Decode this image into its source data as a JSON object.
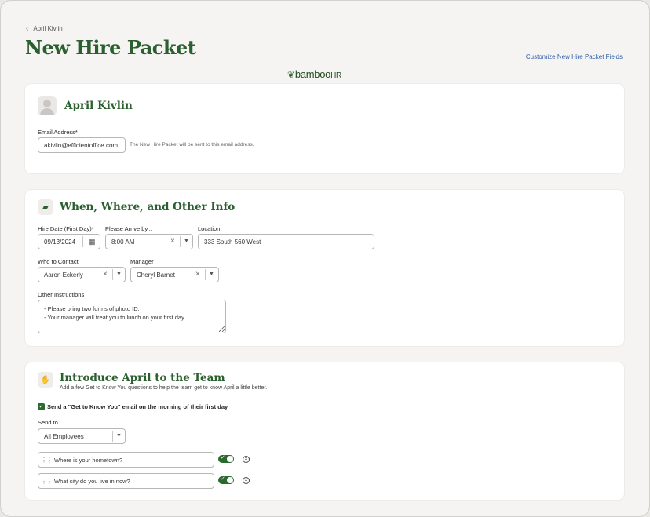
{
  "breadcrumb": {
    "back_label": "April Kivlin"
  },
  "page_title": "New Hire Packet",
  "customize_link": "Customize New Hire Packet Fields",
  "logo": {
    "text": "bamboo",
    "suffix": "HR"
  },
  "employee_card": {
    "name": "April Kivlin",
    "email_label": "Email Address*",
    "email_value": "akivlin@efficientoffice.com",
    "email_hint": "The New Hire Packet will be sent to this email address."
  },
  "info_section": {
    "title": "When, Where, and Other Info",
    "hire_date_label": "Hire Date (First Day)*",
    "hire_date_value": "09/13/2024",
    "arrive_label": "Please Arrive by...",
    "arrive_value": "8:00 AM",
    "location_label": "Location",
    "location_value": "333 South 560 West",
    "contact_label": "Who to Contact",
    "contact_value": "Aaron Eckerly",
    "manager_label": "Manager",
    "manager_value": "Cheryl Barnet",
    "instructions_label": "Other Instructions",
    "instructions_value": "- Please bring two forms of photo ID.\n- Your manager will treat you to lunch on your first day."
  },
  "team_section": {
    "title": "Introduce April to the Team",
    "subtitle": "Add a few Get to Know You questions to help the team get to know April a little better.",
    "send_email_label": "Send a \"Get to Know You\" email on the morning of their first day",
    "send_email_checked": true,
    "send_to_label": "Send to",
    "send_to_value": "All Employees",
    "questions": [
      {
        "text": "Where is your hometown?",
        "enabled": true
      },
      {
        "text": "What city do you live in now?",
        "enabled": true
      }
    ]
  },
  "colors": {
    "brand_green": "#2b5f2f",
    "link_blue": "#2f5fa8",
    "toggle_green": "#2b6a2f"
  }
}
